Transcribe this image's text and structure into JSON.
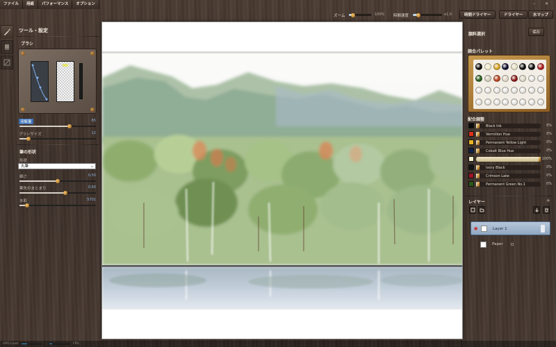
{
  "menu": [
    {
      "id": "file",
      "label": "ファイル"
    },
    {
      "id": "paper",
      "label": "用紙"
    },
    {
      "id": "performance",
      "label": "パフォーマンス"
    },
    {
      "id": "options",
      "label": "オプション"
    }
  ],
  "window": {
    "minimize": "–",
    "close": "✕"
  },
  "toolbar": {
    "zoom_label": "ズーム",
    "zoom_value": "100%",
    "zoom_level": 0.2,
    "time_speed_label": "時間速度",
    "time_speed_value": "x1.0",
    "time_speed_level": 0.2,
    "time_dryer_label": "時間ドライヤー",
    "dryer_label": "ドライヤー",
    "watermap_label": "水マップ"
  },
  "left_panel": {
    "title": "ツール・設定",
    "tool_tabs": [
      "brush-tool",
      "eraser-tool",
      "paper-tool"
    ],
    "brush_section": "ブラシ",
    "sliders": [
      {
        "label": "溶解量",
        "value": "65",
        "level": 0.65,
        "selected": true
      },
      {
        "label": "ブラシサイズ",
        "value": "12",
        "level": 0.12,
        "selected": false
      }
    ],
    "shape_section": "筆の形状",
    "shape_label": "形状",
    "shape_value": "丸筆",
    "shape_sliders": [
      {
        "label": "細さ",
        "value": "0.50",
        "level": 0.5
      },
      {
        "label": "筆先のまとまり",
        "value": "0.60",
        "level": 0.6
      },
      {
        "label": "水彩",
        "value": "5701",
        "level": 0.1
      }
    ]
  },
  "right_panel": {
    "pigment_label": "顔料選択",
    "save_label": "保存",
    "palette_label": "調合パレット",
    "palette_wells": [
      "#0b0b0b",
      "#f3eed0",
      "#d9a321",
      "#101030",
      "#e9e3c8",
      "#0d0d0d",
      "#0c0c0c",
      "#b01c1c",
      "#245a1a",
      "#d6cfbf",
      "#b8401c",
      "#e0d8c6",
      "#8a1818",
      "#e0d8c6",
      "",
      "",
      "",
      "",
      "",
      "",
      "",
      "",
      "",
      "",
      "",
      "",
      "",
      "",
      "",
      "",
      "",
      ""
    ],
    "mix_label": "配合調整",
    "pigments": [
      {
        "name": "Black Ink",
        "color": "#0b0b0b",
        "pct": "0%",
        "level": 0.02,
        "swatch_in_bar": false
      },
      {
        "name": "Vermilion Hue",
        "color": "#d9321b",
        "pct": "0%",
        "level": 0.02,
        "swatch_in_bar": false
      },
      {
        "name": "Permanent Yellow Light",
        "color": "#e6b324",
        "pct": "0%",
        "level": 0.02,
        "swatch_in_bar": false
      },
      {
        "name": "Cobalt Blue Hue",
        "color": "#10204a",
        "pct": "0%",
        "level": 0.02,
        "swatch_in_bar": false
      },
      {
        "name": "",
        "color": "#f2ecc8",
        "pct": "100%",
        "level": 1.0,
        "swatch_in_bar": true
      },
      {
        "name": "Ivory Black",
        "color": "#141414",
        "pct": "0%",
        "level": 0.02,
        "swatch_in_bar": false
      },
      {
        "name": "Crimson Lake",
        "color": "#9e1524",
        "pct": "0%",
        "level": 0.02,
        "swatch_in_bar": false
      },
      {
        "name": "Permanent Green No.1",
        "color": "#2a5a1b",
        "pct": "0%",
        "level": 0.02,
        "swatch_in_bar": false
      }
    ],
    "layers_label": "レイヤー",
    "layers": [
      {
        "name": "Layer 1",
        "selected": true
      },
      {
        "name": "Paper",
        "selected": false
      }
    ]
  },
  "status": {
    "gpu_label": "GPU Load:",
    "frame_label": "FPS:"
  }
}
